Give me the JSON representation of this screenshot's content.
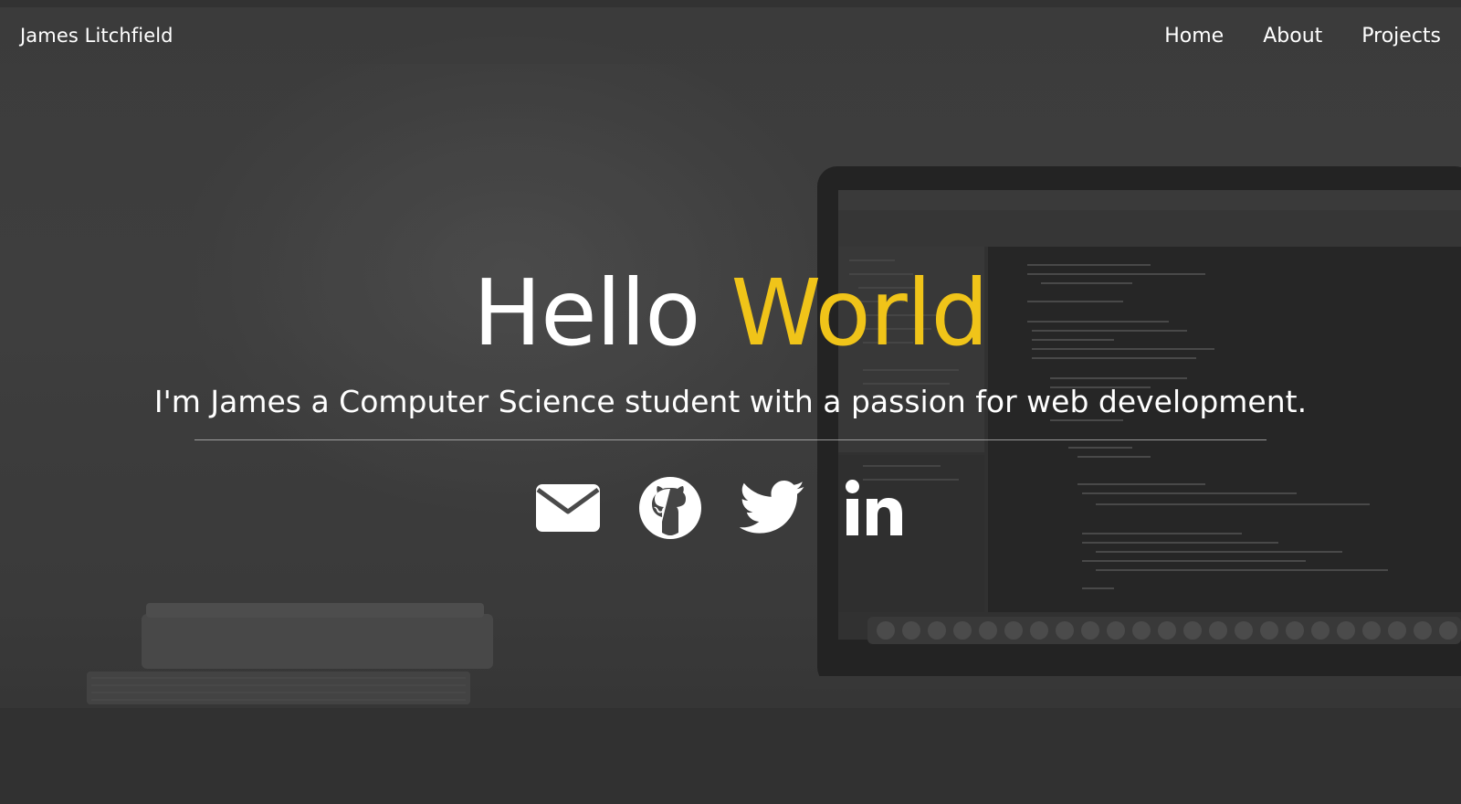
{
  "navbar": {
    "brand": "James Litchfield",
    "links": [
      {
        "label": "Home"
      },
      {
        "label": "About"
      },
      {
        "label": "Projects"
      }
    ]
  },
  "hero": {
    "title_part1": "Hello",
    "title_part2": "World",
    "subtitle": "I'm James a Computer Science student with a passion for web development."
  },
  "socials": [
    {
      "icon": "envelope-icon"
    },
    {
      "icon": "github-icon"
    },
    {
      "icon": "twitter-icon"
    },
    {
      "icon": "linkedin-icon"
    }
  ],
  "colors": {
    "accent": "#f0c419",
    "navbar_bg": "#3c3c3c",
    "text": "#ffffff"
  }
}
